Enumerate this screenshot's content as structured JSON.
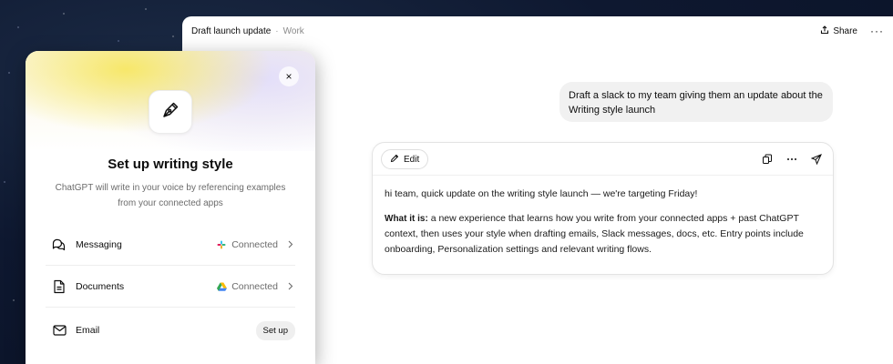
{
  "chat": {
    "title": "Draft launch update",
    "separator": "·",
    "project": "Work",
    "share_label": "Share",
    "more_label": "···",
    "user_message": "Draft a slack to my team giving them an update about the Writing style launch",
    "response": {
      "edit_label": "Edit",
      "paragraph1": "hi team, quick update on the writing style launch — we're targeting Friday!",
      "paragraph2_label": "What it is:",
      "paragraph2_text": " a new experience that learns how you write from your connected apps + past ChatGPT context, then uses your style when drafting emails, Slack messages, docs, etc. Entry points include onboarding, Personalization settings and relevant writing flows."
    }
  },
  "panel": {
    "title": "Set up writing style",
    "description": "ChatGPT will write in your voice by referencing examples from your connected apps",
    "close_label": "×",
    "items": [
      {
        "label": "Messaging",
        "status": "Connected",
        "icon": "chat-bubbles-icon",
        "app_icon": "slack-icon"
      },
      {
        "label": "Documents",
        "status": "Connected",
        "icon": "document-icon",
        "app_icon": "google-drive-icon"
      },
      {
        "label": "Email",
        "action": "Set up",
        "icon": "mail-icon"
      }
    ]
  },
  "colors": {
    "accent_yellow": "#f7e86a",
    "accent_lavender": "#e3defa",
    "background_dark": "#0e1830"
  }
}
